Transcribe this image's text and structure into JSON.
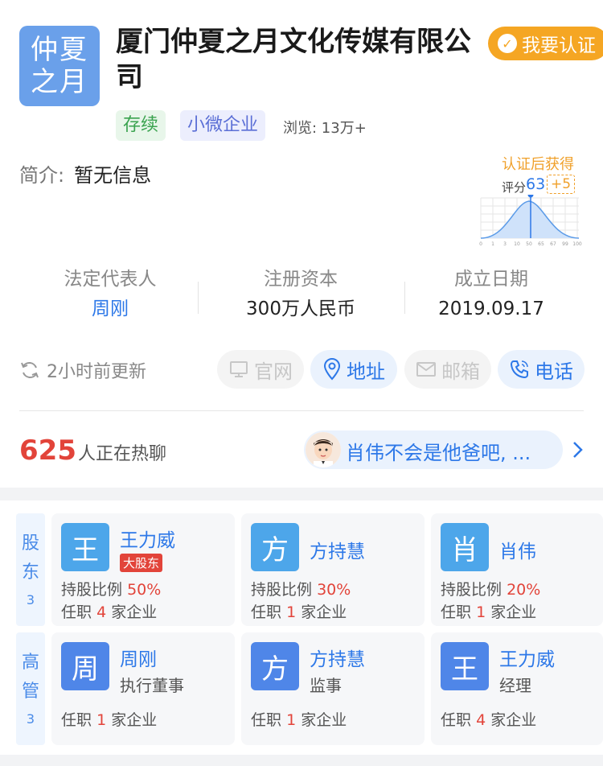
{
  "company": {
    "logo_line1": "仲夏",
    "logo_line2": "之月",
    "name": "厦门仲夏之月文化传媒有限公司",
    "status_tag": "存续",
    "type_tag": "小微企业",
    "views": "浏览: 13万+",
    "intro_label": "简介:",
    "intro_value": "暂无信息"
  },
  "certify_button": "我要认证",
  "score": {
    "title": "认证后获得",
    "label": "评分",
    "value": "63",
    "bonus": "+5",
    "axis_ticks": [
      "0",
      "1",
      "3",
      "10",
      "50",
      "65",
      "67",
      "99",
      "100"
    ]
  },
  "info": [
    {
      "label": "法定代表人",
      "value": "周刚"
    },
    {
      "label": "注册资本",
      "value": "300万人民币"
    },
    {
      "label": "成立日期",
      "value": "2019.09.17"
    }
  ],
  "updated": "2小时前更新",
  "actions": [
    {
      "label": "官网",
      "icon": "monitor-icon",
      "enabled": false
    },
    {
      "label": "地址",
      "icon": "location-icon",
      "enabled": true
    },
    {
      "label": "邮箱",
      "icon": "mail-icon",
      "enabled": false
    },
    {
      "label": "电话",
      "icon": "phone-icon",
      "enabled": true
    }
  ],
  "hot": {
    "count": "625",
    "text": "人正在热聊",
    "message": "肖伟不会是他爸吧, ..."
  },
  "shareholders": {
    "title_1": "股",
    "title_2": "东",
    "count": "3",
    "items": [
      {
        "avatar": "王",
        "name": "王力威",
        "badge": "大股东",
        "ratio_label": "持股比例",
        "ratio": "50%",
        "job_prefix": "任职",
        "job_count": "4",
        "job_suffix": "家企业"
      },
      {
        "avatar": "方",
        "name": "方持慧",
        "ratio_label": "持股比例",
        "ratio": "30%",
        "job_prefix": "任职",
        "job_count": "1",
        "job_suffix": "家企业"
      },
      {
        "avatar": "肖",
        "name": "肖伟",
        "ratio_label": "持股比例",
        "ratio": "20%",
        "job_prefix": "任职",
        "job_count": "1",
        "job_suffix": "家企业"
      }
    ]
  },
  "executives": {
    "title_1": "高",
    "title_2": "管",
    "count": "3",
    "items": [
      {
        "avatar": "周",
        "name": "周刚",
        "role": "执行董事",
        "job_prefix": "任职",
        "job_count": "1",
        "job_suffix": "家企业"
      },
      {
        "avatar": "方",
        "name": "方持慧",
        "role": "监事",
        "job_prefix": "任职",
        "job_count": "1",
        "job_suffix": "家企业"
      },
      {
        "avatar": "王",
        "name": "王力威",
        "role": "经理",
        "job_prefix": "任职",
        "job_count": "4",
        "job_suffix": "家企业"
      }
    ]
  }
}
